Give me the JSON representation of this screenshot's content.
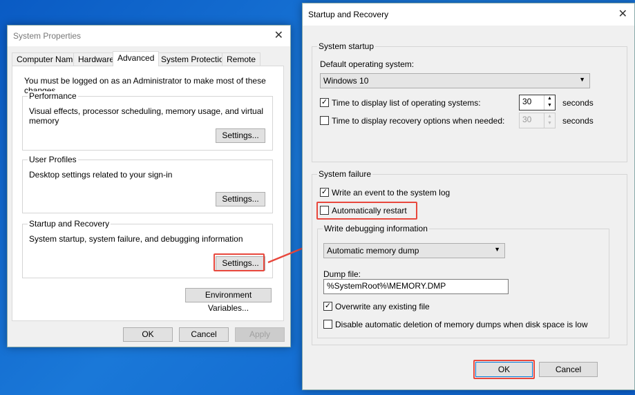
{
  "system_properties": {
    "title": "System Properties",
    "tabs": [
      "Computer Name",
      "Hardware",
      "Advanced",
      "System Protection",
      "Remote"
    ],
    "active_tab": "Advanced",
    "admin_note": "You must be logged on as an Administrator to make most of these changes.",
    "performance": {
      "label": "Performance",
      "desc": "Visual effects, processor scheduling, memory usage, and virtual memory",
      "button": "Settings..."
    },
    "user_profiles": {
      "label": "User Profiles",
      "desc": "Desktop settings related to your sign-in",
      "button": "Settings..."
    },
    "startup_recovery": {
      "label": "Startup and Recovery",
      "desc": "System startup, system failure, and debugging information",
      "button": "Settings..."
    },
    "env_button": "Environment Variables...",
    "ok": "OK",
    "cancel": "Cancel",
    "apply": "Apply"
  },
  "startup_recovery": {
    "title": "Startup and Recovery",
    "system_startup": {
      "label": "System startup",
      "default_os_label": "Default operating system:",
      "default_os_value": "Windows 10",
      "time_list_label": "Time to display list of operating systems:",
      "time_list_checked": true,
      "time_list_value": "30",
      "time_recovery_label": "Time to display recovery options when needed:",
      "time_recovery_checked": false,
      "time_recovery_value": "30",
      "seconds": "seconds"
    },
    "system_failure": {
      "label": "System failure",
      "write_event_label": "Write an event to the system log",
      "write_event_checked": true,
      "auto_restart_label": "Automatically restart",
      "auto_restart_checked": false,
      "debug_label": "Write debugging information",
      "debug_value": "Automatic memory dump",
      "dump_file_label": "Dump file:",
      "dump_file_value": "%SystemRoot%\\MEMORY.DMP",
      "overwrite_label": "Overwrite any existing file",
      "overwrite_checked": true,
      "disable_label": "Disable automatic deletion of memory dumps when disk space is low",
      "disable_checked": false
    },
    "ok": "OK",
    "cancel": "Cancel"
  },
  "colors": {
    "highlight": "#e8473c"
  }
}
